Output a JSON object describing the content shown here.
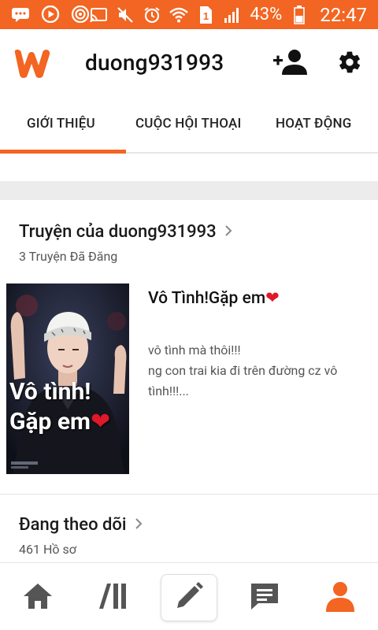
{
  "status_bar": {
    "battery_percent": "43%",
    "time": "22:47",
    "icons": [
      "message-icon",
      "youtube-icon",
      "circle-icon",
      "cast-icon",
      "mute-icon",
      "alarm-icon",
      "wifi-icon",
      "sim-1-icon",
      "signal-icon",
      "battery-icon"
    ]
  },
  "header": {
    "username": "duong931993",
    "icons": [
      "wattpad-logo",
      "follow-icon",
      "settings-icon"
    ]
  },
  "tabs": [
    {
      "label": "GIỚI THIỆU",
      "active": true
    },
    {
      "label": "CUỘC HỘI THOẠI",
      "active": false
    },
    {
      "label": "HOẠT ĐỘNG",
      "active": false
    }
  ],
  "stories": {
    "title": "Truyện của duong931993",
    "count_label": "3 Truyện Đã Đăng",
    "items": [
      {
        "title": "Vô Tình!Gặp em❤",
        "description": "vô tình mà thôi!!!\nng con trai kia đi trên đường cz vô tình!!!...",
        "cover_line1": "Vô tình!",
        "cover_line2": "Gặp em❤"
      }
    ]
  },
  "following": {
    "title": "Đang theo dõi",
    "count_label": "461 Hồ sơ"
  },
  "bottom_nav": {
    "items": [
      "home-icon",
      "library-icon",
      "write-icon",
      "messages-icon",
      "profile-icon"
    ],
    "active": "profile-icon"
  },
  "colors": {
    "brand_orange": "#f26522",
    "text_dark": "#111111",
    "text_muted": "#555555",
    "icon_gray": "#555555"
  }
}
